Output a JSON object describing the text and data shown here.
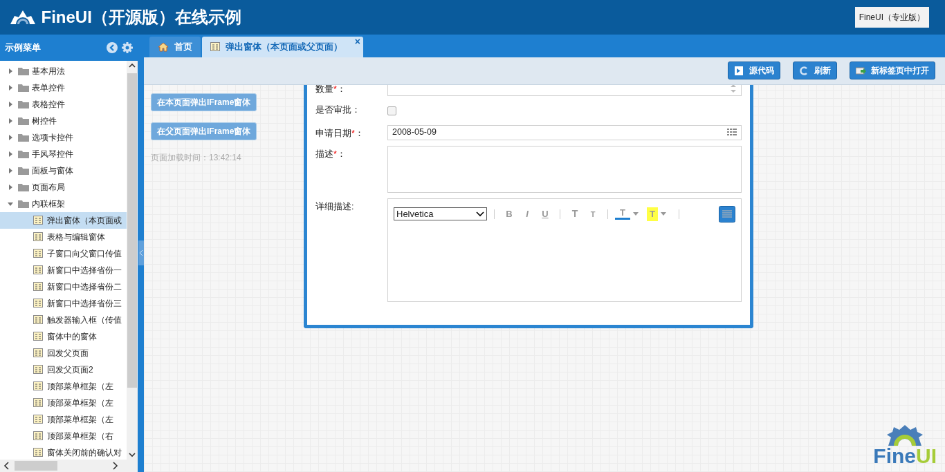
{
  "header": {
    "title": "FineUI（开源版）在线示例",
    "pro_link": "FineUI（专业版）"
  },
  "sidebar": {
    "title": "示例菜单",
    "tree": [
      {
        "label": "基本用法",
        "expanded": false,
        "selected": false
      },
      {
        "label": "表单控件",
        "expanded": false,
        "selected": false
      },
      {
        "label": "表格控件",
        "expanded": false,
        "selected": false
      },
      {
        "label": "树控件",
        "expanded": false,
        "selected": false
      },
      {
        "label": "选项卡控件",
        "expanded": false,
        "selected": false
      },
      {
        "label": "手风琴控件",
        "expanded": false,
        "selected": false
      },
      {
        "label": "面板与窗体",
        "expanded": false,
        "selected": false
      },
      {
        "label": "页面布局",
        "expanded": false,
        "selected": false
      },
      {
        "label": "内联框架",
        "expanded": true,
        "selected": false,
        "children": [
          {
            "label": "弹出窗体（本页面或",
            "selected": true
          },
          {
            "label": "表格与编辑窗体",
            "selected": false
          },
          {
            "label": "子窗口向父窗口传值",
            "selected": false
          },
          {
            "label": "新窗口中选择省份一",
            "selected": false
          },
          {
            "label": "新窗口中选择省份二",
            "selected": false
          },
          {
            "label": "新窗口中选择省份三",
            "selected": false
          },
          {
            "label": "触发器输入框（传值",
            "selected": false
          },
          {
            "label": "窗体中的窗体",
            "selected": false
          },
          {
            "label": "回发父页面",
            "selected": false
          },
          {
            "label": "回发父页面2",
            "selected": false
          },
          {
            "label": "顶部菜单框架（左",
            "selected": false
          },
          {
            "label": "顶部菜单框架（左",
            "selected": false
          },
          {
            "label": "顶部菜单框架（左",
            "selected": false
          },
          {
            "label": "顶部菜单框架（右",
            "selected": false
          },
          {
            "label": "窗体关闭前的确认对",
            "selected": false
          }
        ]
      }
    ]
  },
  "tabs": [
    {
      "kind": "home",
      "label": "首页",
      "selected": false
    },
    {
      "kind": "page",
      "label": "弹出窗体（本页面或父页面）",
      "selected": true,
      "close": "×"
    }
  ],
  "toolbar": [
    {
      "kind": "source",
      "label": "源代码"
    },
    {
      "kind": "refresh",
      "label": "刷新"
    },
    {
      "kind": "newtab",
      "label": "新标签页中打开"
    }
  ],
  "page": {
    "buttons": [
      {
        "label": "在本页面弹出IFrame窗体",
        "disabled": true
      },
      {
        "label": "在父页面弹出IFrame窗体",
        "disabled": true
      }
    ],
    "load_time": "页面加载时间：13:42:14"
  },
  "form": {
    "fields": [
      {
        "kind": "number",
        "label": "数量",
        "required_mark": "*",
        "label_end": "："
      },
      {
        "kind": "checkbox",
        "label": "是否审批",
        "label_end": "：",
        "checked": false
      },
      {
        "kind": "date",
        "label": "申请日期",
        "required_mark": "*",
        "label_end": "：",
        "value": "2008-05-09"
      },
      {
        "kind": "textarea",
        "label": "描述",
        "required_mark": "*",
        "label_end": "："
      },
      {
        "kind": "editor",
        "label": "详细描述",
        "label_end": ":",
        "font": "Helvetica",
        "tools": [
          {
            "kind": "bold",
            "glyph": "B"
          },
          {
            "kind": "italic",
            "glyph": "I"
          },
          {
            "kind": "underline",
            "glyph": "U"
          },
          {
            "kind": "sep"
          },
          {
            "kind": "grow",
            "glyph": "T"
          },
          {
            "kind": "shrink",
            "glyph": "T"
          },
          {
            "kind": "sep"
          },
          {
            "kind": "forecolor",
            "glyph": "T"
          },
          {
            "kind": "backcolor",
            "glyph": "T"
          },
          {
            "kind": "sep"
          }
        ]
      }
    ]
  },
  "logo": [
    "Fine",
    "UI"
  ]
}
